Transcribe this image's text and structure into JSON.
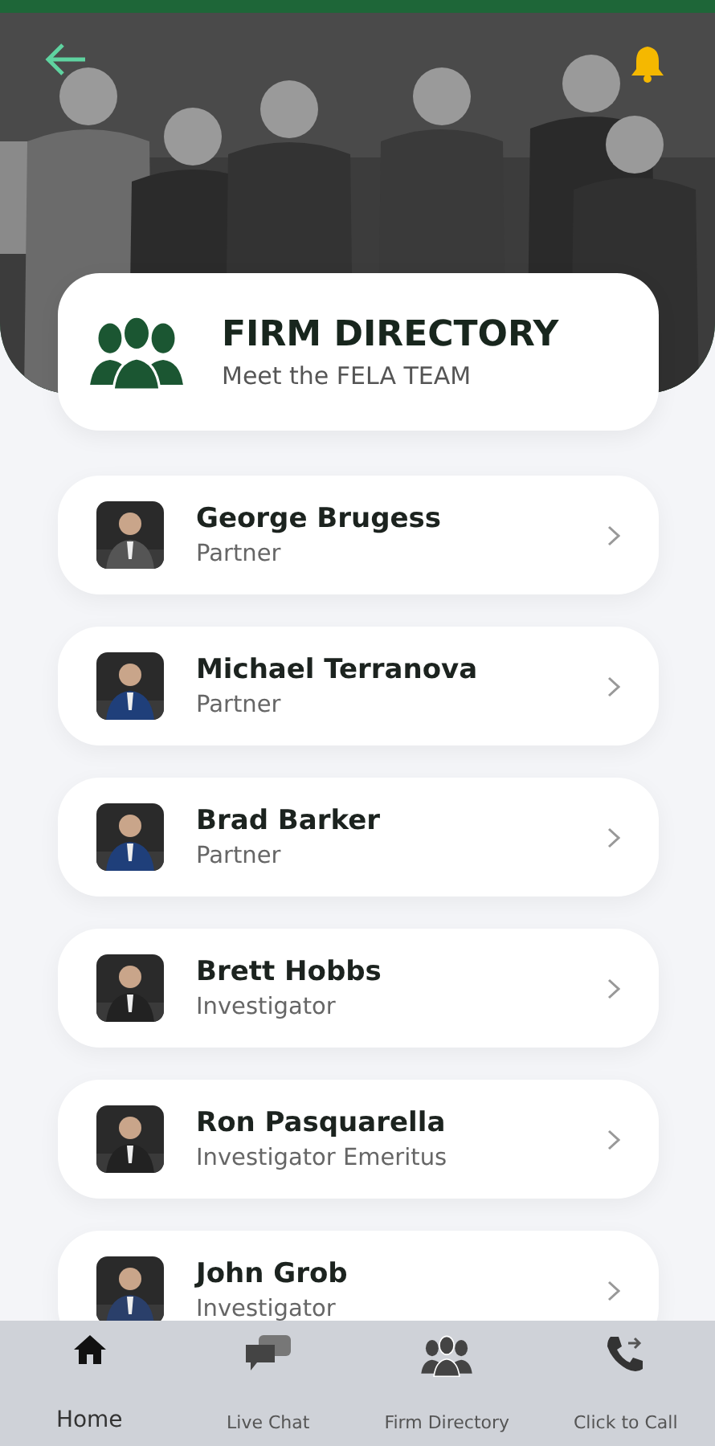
{
  "directory": {
    "title": "FIRM DIRECTORY",
    "subtitle": "Meet the FELA TEAM"
  },
  "people": [
    {
      "name": "George Brugess",
      "role": "Partner"
    },
    {
      "name": "Michael Terranova",
      "role": "Partner"
    },
    {
      "name": "Brad Barker",
      "role": "Partner"
    },
    {
      "name": "Brett Hobbs",
      "role": "Investigator"
    },
    {
      "name": "Ron Pasquarella",
      "role": "Investigator Emeritus"
    },
    {
      "name": "John Grob",
      "role": "Investigator"
    }
  ],
  "nav": [
    {
      "kind": "home",
      "label": "Home",
      "selected": true
    },
    {
      "kind": "chat",
      "label": "Live Chat",
      "selected": false
    },
    {
      "kind": "directory",
      "label": "Firm Directory",
      "selected": false
    },
    {
      "kind": "call",
      "label": "Click to Call",
      "selected": false
    }
  ]
}
